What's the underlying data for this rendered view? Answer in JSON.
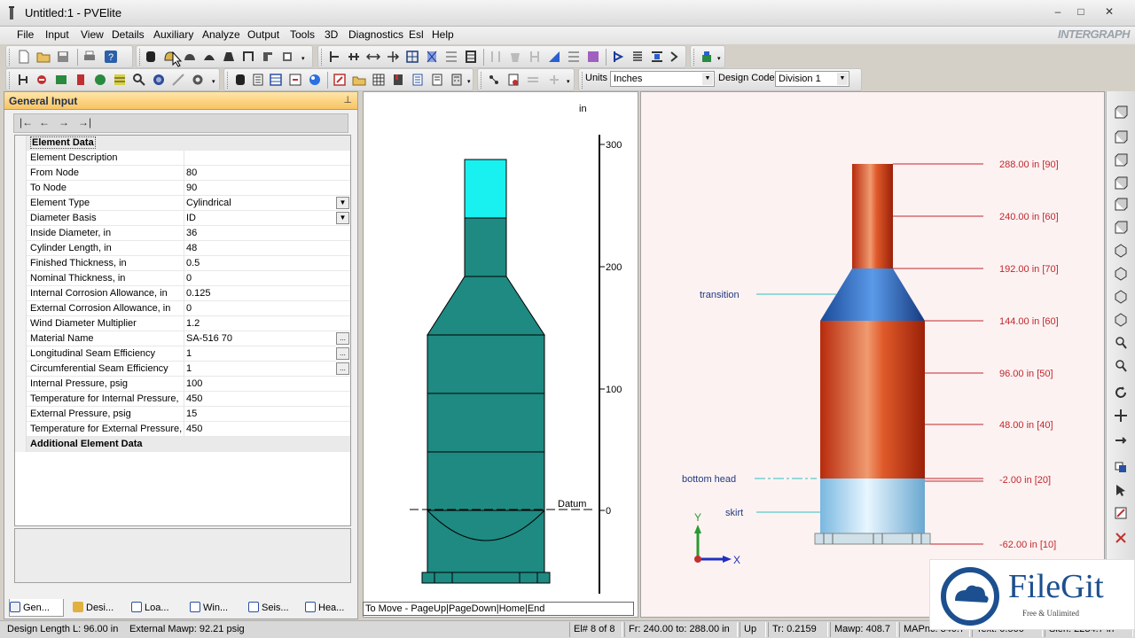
{
  "window": {
    "title": "Untitled:1 - PVElite",
    "minimize": "–",
    "maximize": "□",
    "close": "✕"
  },
  "menu": [
    "File",
    "Input",
    "View",
    "Details",
    "Auxiliary",
    "Analyze",
    "Output",
    "Tools",
    "3D",
    "Diagnostics",
    "Esl",
    "Help"
  ],
  "brand": "INTERGRAPH",
  "toolbar": {
    "units_label": "Units",
    "units_value": "Inches",
    "design_code_label": "Design Code",
    "design_code_value": "Division 1"
  },
  "panel": {
    "title": "General Input",
    "pin": "ᵖ",
    "nav": [
      "|←",
      "←",
      "→",
      "→|"
    ],
    "section_title": "Element Data",
    "rows": [
      {
        "label": "Element Description",
        "value": ""
      },
      {
        "label": "From Node",
        "value": "80"
      },
      {
        "label": "To Node",
        "value": "90"
      },
      {
        "label": "Element Type",
        "value": "Cylindrical"
      },
      {
        "label": "Diameter Basis",
        "value": "ID"
      },
      {
        "label": "Inside Diameter, in",
        "value": "36"
      },
      {
        "label": "Cylinder Length, in",
        "value": "48"
      },
      {
        "label": "Finished Thickness, in",
        "value": "0.5"
      },
      {
        "label": "Nominal Thickness,  in",
        "value": "0"
      },
      {
        "label": "Internal Corrosion Allowance,  in",
        "value": "0.125"
      },
      {
        "label": "External Corrosion Allowance,  in",
        "value": "0"
      },
      {
        "label": "Wind Diameter Multiplier",
        "value": "1.2"
      },
      {
        "label": "Material Name",
        "value": "SA-516 70"
      },
      {
        "label": "Longitudinal Seam Efficiency",
        "value": "1"
      },
      {
        "label": "Circumferential Seam Efficiency",
        "value": "1"
      },
      {
        "label": "Internal Pressure,  psig",
        "value": "100"
      },
      {
        "label": "Temperature for Internal Pressure,",
        "value": "450"
      },
      {
        "label": "External Pressure,  psig",
        "value": "15"
      },
      {
        "label": "Temperature for External Pressure,",
        "value": "450"
      }
    ],
    "additional_title": "Additional Element Data",
    "dropdown_glyph": "▼",
    "ellipsis_glyph": "...",
    "collapse_glyph": "−"
  },
  "bottom_tabs": [
    "Gen...",
    "Desi...",
    "Loa...",
    "Win...",
    "Seis...",
    "Hea..."
  ],
  "elevation": {
    "unit": "in",
    "ticks": [
      "300",
      "200",
      "100",
      "0"
    ],
    "datum_label": "Datum",
    "move_hint": "To Move - PageUp|PageDown|Home|End"
  },
  "view3d": {
    "levels": [
      "288.00 in  [90]",
      "240.00 in  [60]",
      "192.00 in  [70]",
      "144.00 in  [60]",
      "96.00 in  [50]",
      "48.00 in  [40]",
      "-2.00 in  [20]",
      "-62.00 in  [10]"
    ],
    "annotations": [
      "transition",
      "bottom head",
      "skirt"
    ],
    "axes": {
      "y": "Y",
      "x": "X"
    }
  },
  "status": {
    "design_length": "Design Length L: 96.00 in",
    "external_mawp": "External Mawp: 92.21 psig",
    "element": "El# 8 of 8",
    "from_to": "Fr: 240.00 to: 288.00 in",
    "direction": "Up",
    "tr": "Tr: 0.2159",
    "mawp": "Mawp: 408.7",
    "mapnc": "MAPnc: 340.7",
    "text": "Text: 0.500",
    "slen": "Slen: 2234.7 in"
  },
  "watermark": {
    "name": "FileGit",
    "tagline": "Free & Unlimited"
  },
  "colors": {
    "panel_header": "#f7c463",
    "cyan_segment": "#19f0f0",
    "teal_vessel": "#1e8a82",
    "red_shell": "#d8401c",
    "blue_cone": "#2b70c8",
    "skirt": "#9fd6f0",
    "level_label": "#c0282c",
    "annotation": "#203a80"
  }
}
